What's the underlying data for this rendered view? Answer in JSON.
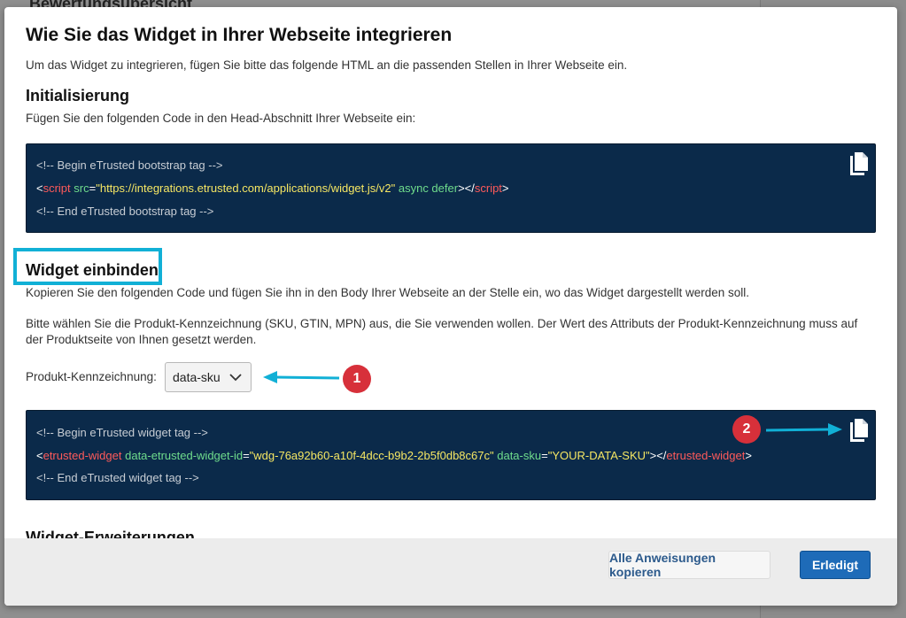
{
  "background": {
    "heading": "Bewertungsübersicht"
  },
  "modal": {
    "title": "Wie Sie das Widget in Ihrer Webseite integrieren",
    "intro": "Um das Widget zu integrieren, fügen Sie bitte das folgende HTML an die passenden Stellen in Ihrer Webseite ein.",
    "init": {
      "heading": "Initialisierung",
      "description": "Fügen Sie den folgenden Code in den Head-Abschnitt Ihrer Webseite ein:",
      "code": {
        "comment_begin": "<!-- Begin eTrusted bootstrap tag -->",
        "lt": "<",
        "tag": "script",
        "attr_src": "src",
        "eq": "=",
        "src_value": "\"https://integrations.etrusted.com/applications/widget.js/v2\"",
        "attrs_tail": "async defer",
        "close_mid": "></",
        "tag_close": "script",
        "gt": ">",
        "comment_end": "<!-- End eTrusted bootstrap tag -->"
      }
    },
    "widget": {
      "heading": "Widget einbinden",
      "description": "Kopieren Sie den folgenden Code und fügen Sie ihn in den Body Ihrer Webseite an der Stelle ein, wo das Widget dargestellt werden soll.",
      "note_line1": "Bitte wählen Sie die Produkt-Kennzeichnung (SKU, GTIN, MPN) aus, die Sie verwenden wollen. Der Wert des Attributs der Produkt-Kennzeichnung muss auf",
      "note_line2": "der Produktseite von Ihnen gesetzt werden.",
      "select_label": "Produkt-Kennzeichnung:",
      "select_value": "data-sku",
      "code": {
        "comment_begin": "<!-- Begin eTrusted widget tag -->",
        "lt": "<",
        "tag": "etrusted-widget",
        "attr_id": "data-etrusted-widget-id",
        "eq": "=",
        "id_value": "\"wdg-76a92b60-a10f-4dcc-b9b2-2b5f0db8c67c\"",
        "attr_sku": "data-sku",
        "eq2": "=",
        "sku_value": "\"YOUR-DATA-SKU\"",
        "close_mid": "></",
        "tag_close": "etrusted-widget",
        "gt": ">",
        "comment_end": "<!-- End eTrusted widget tag -->"
      }
    },
    "next_heading": "Widget-Erweiterungen",
    "annotations": {
      "badge1": "1",
      "badge2": "2"
    },
    "footer": {
      "copy_all_label": "Alle Anweisungen kopieren",
      "done_label": "Erledigt"
    }
  },
  "colors": {
    "code_bg": "#0b2a4a",
    "highlight": "#11b0d6",
    "badge": "#d7303a",
    "arrow": "#11b0d6",
    "primary": "#1e6bb8"
  }
}
